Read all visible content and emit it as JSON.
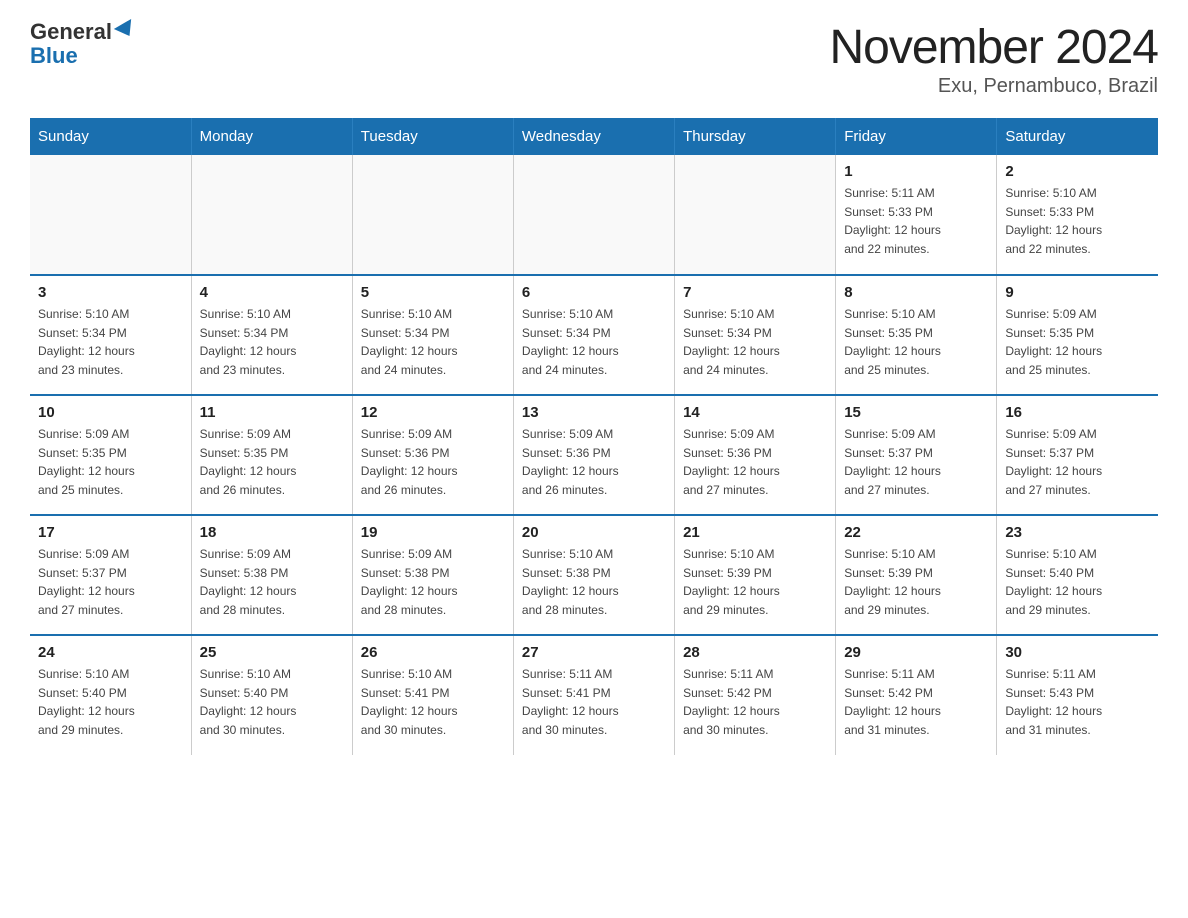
{
  "header": {
    "logo_general": "General",
    "logo_blue": "Blue",
    "title": "November 2024",
    "subtitle": "Exu, Pernambuco, Brazil"
  },
  "days_of_week": [
    "Sunday",
    "Monday",
    "Tuesday",
    "Wednesday",
    "Thursday",
    "Friday",
    "Saturday"
  ],
  "weeks": [
    [
      {
        "day": "",
        "info": ""
      },
      {
        "day": "",
        "info": ""
      },
      {
        "day": "",
        "info": ""
      },
      {
        "day": "",
        "info": ""
      },
      {
        "day": "",
        "info": ""
      },
      {
        "day": "1",
        "info": "Sunrise: 5:11 AM\nSunset: 5:33 PM\nDaylight: 12 hours\nand 22 minutes."
      },
      {
        "day": "2",
        "info": "Sunrise: 5:10 AM\nSunset: 5:33 PM\nDaylight: 12 hours\nand 22 minutes."
      }
    ],
    [
      {
        "day": "3",
        "info": "Sunrise: 5:10 AM\nSunset: 5:34 PM\nDaylight: 12 hours\nand 23 minutes."
      },
      {
        "day": "4",
        "info": "Sunrise: 5:10 AM\nSunset: 5:34 PM\nDaylight: 12 hours\nand 23 minutes."
      },
      {
        "day": "5",
        "info": "Sunrise: 5:10 AM\nSunset: 5:34 PM\nDaylight: 12 hours\nand 24 minutes."
      },
      {
        "day": "6",
        "info": "Sunrise: 5:10 AM\nSunset: 5:34 PM\nDaylight: 12 hours\nand 24 minutes."
      },
      {
        "day": "7",
        "info": "Sunrise: 5:10 AM\nSunset: 5:34 PM\nDaylight: 12 hours\nand 24 minutes."
      },
      {
        "day": "8",
        "info": "Sunrise: 5:10 AM\nSunset: 5:35 PM\nDaylight: 12 hours\nand 25 minutes."
      },
      {
        "day": "9",
        "info": "Sunrise: 5:09 AM\nSunset: 5:35 PM\nDaylight: 12 hours\nand 25 minutes."
      }
    ],
    [
      {
        "day": "10",
        "info": "Sunrise: 5:09 AM\nSunset: 5:35 PM\nDaylight: 12 hours\nand 25 minutes."
      },
      {
        "day": "11",
        "info": "Sunrise: 5:09 AM\nSunset: 5:35 PM\nDaylight: 12 hours\nand 26 minutes."
      },
      {
        "day": "12",
        "info": "Sunrise: 5:09 AM\nSunset: 5:36 PM\nDaylight: 12 hours\nand 26 minutes."
      },
      {
        "day": "13",
        "info": "Sunrise: 5:09 AM\nSunset: 5:36 PM\nDaylight: 12 hours\nand 26 minutes."
      },
      {
        "day": "14",
        "info": "Sunrise: 5:09 AM\nSunset: 5:36 PM\nDaylight: 12 hours\nand 27 minutes."
      },
      {
        "day": "15",
        "info": "Sunrise: 5:09 AM\nSunset: 5:37 PM\nDaylight: 12 hours\nand 27 minutes."
      },
      {
        "day": "16",
        "info": "Sunrise: 5:09 AM\nSunset: 5:37 PM\nDaylight: 12 hours\nand 27 minutes."
      }
    ],
    [
      {
        "day": "17",
        "info": "Sunrise: 5:09 AM\nSunset: 5:37 PM\nDaylight: 12 hours\nand 27 minutes."
      },
      {
        "day": "18",
        "info": "Sunrise: 5:09 AM\nSunset: 5:38 PM\nDaylight: 12 hours\nand 28 minutes."
      },
      {
        "day": "19",
        "info": "Sunrise: 5:09 AM\nSunset: 5:38 PM\nDaylight: 12 hours\nand 28 minutes."
      },
      {
        "day": "20",
        "info": "Sunrise: 5:10 AM\nSunset: 5:38 PM\nDaylight: 12 hours\nand 28 minutes."
      },
      {
        "day": "21",
        "info": "Sunrise: 5:10 AM\nSunset: 5:39 PM\nDaylight: 12 hours\nand 29 minutes."
      },
      {
        "day": "22",
        "info": "Sunrise: 5:10 AM\nSunset: 5:39 PM\nDaylight: 12 hours\nand 29 minutes."
      },
      {
        "day": "23",
        "info": "Sunrise: 5:10 AM\nSunset: 5:40 PM\nDaylight: 12 hours\nand 29 minutes."
      }
    ],
    [
      {
        "day": "24",
        "info": "Sunrise: 5:10 AM\nSunset: 5:40 PM\nDaylight: 12 hours\nand 29 minutes."
      },
      {
        "day": "25",
        "info": "Sunrise: 5:10 AM\nSunset: 5:40 PM\nDaylight: 12 hours\nand 30 minutes."
      },
      {
        "day": "26",
        "info": "Sunrise: 5:10 AM\nSunset: 5:41 PM\nDaylight: 12 hours\nand 30 minutes."
      },
      {
        "day": "27",
        "info": "Sunrise: 5:11 AM\nSunset: 5:41 PM\nDaylight: 12 hours\nand 30 minutes."
      },
      {
        "day": "28",
        "info": "Sunrise: 5:11 AM\nSunset: 5:42 PM\nDaylight: 12 hours\nand 30 minutes."
      },
      {
        "day": "29",
        "info": "Sunrise: 5:11 AM\nSunset: 5:42 PM\nDaylight: 12 hours\nand 31 minutes."
      },
      {
        "day": "30",
        "info": "Sunrise: 5:11 AM\nSunset: 5:43 PM\nDaylight: 12 hours\nand 31 minutes."
      }
    ]
  ]
}
